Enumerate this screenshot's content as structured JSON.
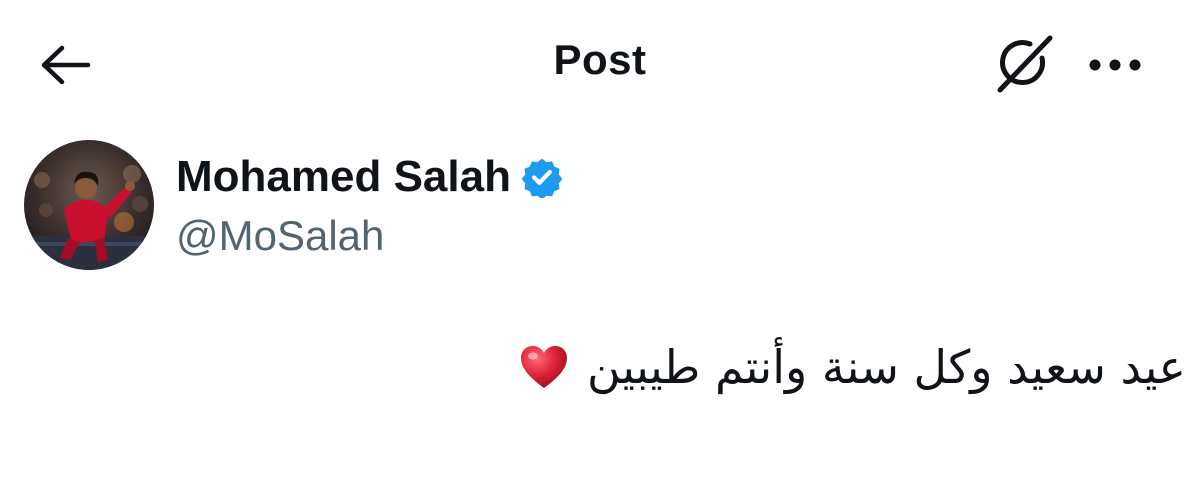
{
  "header": {
    "title": "Post",
    "back_icon": "arrow-left-icon",
    "grok_icon": "grok-icon",
    "more_icon": "more-horizontal-icon"
  },
  "author": {
    "name": "Mohamed Salah",
    "handle": "@MoSalah",
    "verified": true,
    "verified_color": "#1d9bf0",
    "avatar_icon": "avatar"
  },
  "post": {
    "text": "عيد سعيد وكل سنة وأنتم طيبين",
    "emoji": "red-heart-icon"
  },
  "colors": {
    "text_primary": "#0f1419",
    "text_secondary": "#536471",
    "heart": "#e0243b"
  }
}
